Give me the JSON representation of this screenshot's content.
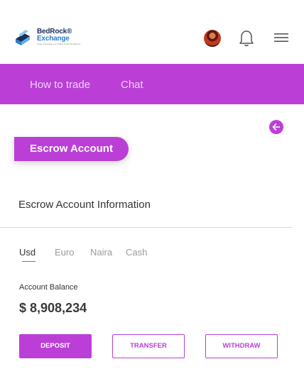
{
  "brand": {
    "line1": "BedRock®",
    "line2": "Exchange",
    "tagline": "Smart Custodian For Digital Financial Markets"
  },
  "icons": {
    "logo": "bedrock-logo-icon",
    "avatar": "user-avatar",
    "bell": "bell-icon",
    "menu": "hamburger-menu-icon",
    "back": "arrow-left-icon"
  },
  "nav": {
    "items": [
      {
        "label": "How to trade"
      },
      {
        "label": "Chat"
      }
    ]
  },
  "page": {
    "section_badge": "Escrow Account",
    "info_title": "Escrow Account Information"
  },
  "currency_tabs": [
    {
      "label": "Usd",
      "active": true
    },
    {
      "label": "Euro",
      "active": false
    },
    {
      "label": "Naira",
      "active": false
    },
    {
      "label": "Cash",
      "active": false
    }
  ],
  "balance": {
    "label": "Account Balance",
    "value": "$ 8,908,234"
  },
  "actions": {
    "deposit": "DEPOSIT",
    "transfer": "TRANSFER",
    "withdraw": "WITHDRAW"
  },
  "colors": {
    "accent": "#bb3fd6",
    "nav_text": "#ecd2f4",
    "logo_navy": "#1b2f5a",
    "logo_blue": "#2a7fd4"
  }
}
